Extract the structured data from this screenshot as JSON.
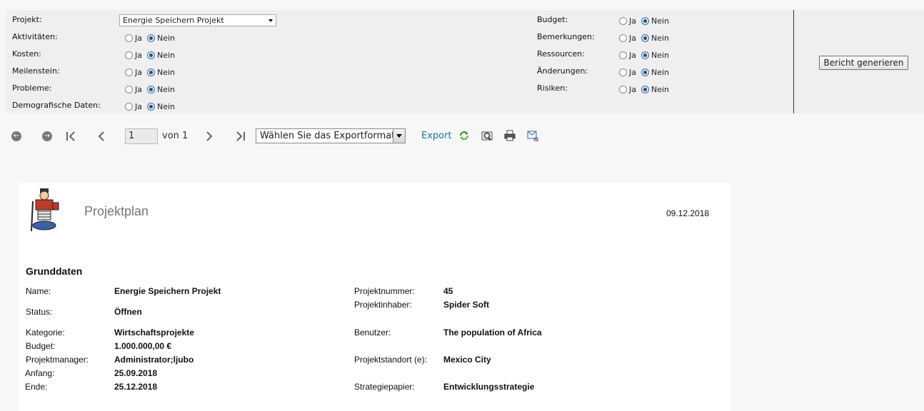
{
  "params": {
    "left": [
      {
        "label": "Projekt:"
      },
      {
        "label": "Aktivitäten:",
        "yes": "Ja",
        "no": "Nein"
      },
      {
        "label": "Kosten:",
        "yes": "Ja",
        "no": "Nein"
      },
      {
        "label": "Meilenstein:",
        "yes": "Ja",
        "no": "Nein"
      },
      {
        "label": "Probleme:",
        "yes": "Ja",
        "no": "Nein"
      },
      {
        "label": "Demografische Daten:",
        "yes": "Ja",
        "no": "Nein"
      }
    ],
    "right": [
      {
        "label": "Budget:",
        "yes": "Ja",
        "no": "Nein"
      },
      {
        "label": "Bemerkungen:",
        "yes": "Ja",
        "no": "Nein"
      },
      {
        "label": "Ressourcen:",
        "yes": "Ja",
        "no": "Nein"
      },
      {
        "label": "Änderungen:",
        "yes": "Ja",
        "no": "Nein"
      },
      {
        "label": "Risiken:",
        "yes": "Ja",
        "no": "Nein"
      }
    ],
    "project_value": "Energie Speichern Projekt",
    "generate_label": "Bericht generieren"
  },
  "toolbar": {
    "page_value": "1",
    "page_of": "von 1",
    "export_format": "Wählen Sie das Exportformat",
    "export_label": "Export"
  },
  "report": {
    "title": "Projektplan",
    "date": "09.12.2018",
    "section": "Grunddaten",
    "left": [
      {
        "label": "Name:",
        "value": "Energie Speichern Projekt"
      },
      {
        "label": "Status:",
        "value": "Öffnen"
      },
      {
        "label": "Kategorie:",
        "value": "Wirtschaftsprojekte"
      },
      {
        "label": "Budget:",
        "value": "1.000.000,00 €"
      },
      {
        "label": "Projektmanager:",
        "value": "Administrator;ljubo"
      },
      {
        "label": "Anfang:",
        "value": "25.09.2018"
      },
      {
        "label": "Ende:",
        "value": "25.12.2018"
      }
    ],
    "right": [
      {
        "label": "Projektnummer:",
        "value": "45"
      },
      {
        "label": "Projektinhaber:",
        "value": "Spider Soft"
      },
      {
        "label": "Benutzer:",
        "value": "The population of Africa"
      },
      {
        "label": "Projektstandort (e):",
        "value": "Mexico City"
      },
      {
        "label": "Strategiepapier:",
        "value": "Entwicklungsstrategie"
      }
    ]
  },
  "icons": {
    "back": "circle-arrow-left-icon",
    "forward": "circle-arrow-right-icon",
    "first": "first-page-icon",
    "prev": "prev-page-icon",
    "next": "next-page-icon",
    "last": "last-page-icon",
    "refresh": "refresh-icon",
    "find": "find-icon",
    "print": "print-icon",
    "email": "email-icon"
  },
  "colors": {
    "link": "#1f6fb0",
    "radio_checked": "#1e4f7e"
  }
}
